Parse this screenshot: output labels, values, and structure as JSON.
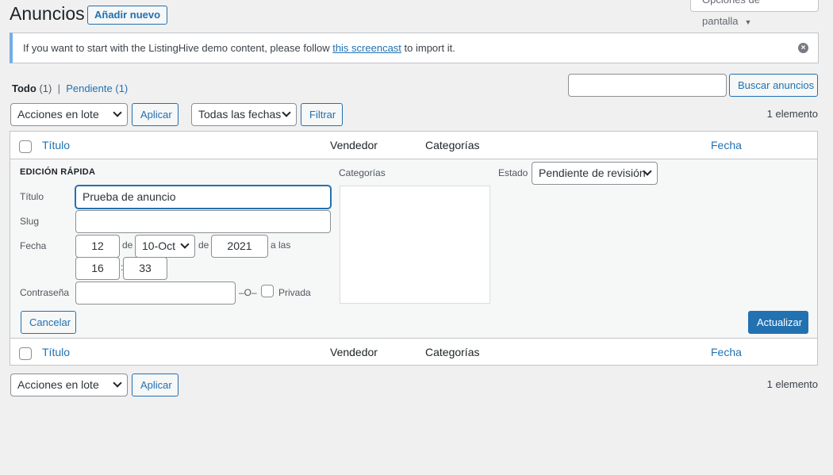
{
  "header": {
    "title": "Anuncios",
    "add_new": "Añadir nuevo",
    "screen_options": "Opciones de pantalla"
  },
  "notice": {
    "text_before": "If you want to start with the ListingHive demo content, please follow ",
    "link": "this screencast",
    "text_after": " to import it."
  },
  "views": {
    "all_label": "Todo",
    "all_count": "(1)",
    "separator": "|",
    "pending_label": "Pendiente",
    "pending_count": "(1)"
  },
  "search": {
    "value": "",
    "button": "Buscar anuncios"
  },
  "tablenav_top": {
    "bulk_actions": "Acciones en lote",
    "apply": "Aplicar",
    "dates": "Todas las fechas",
    "filter": "Filtrar",
    "count": "1 elemento"
  },
  "columns": {
    "title": "Título",
    "vendor": "Vendedor",
    "categories": "Categorías",
    "date": "Fecha"
  },
  "quick_edit": {
    "heading": "EDICIÓN RÁPIDA",
    "title_label": "Título",
    "title_value": "Prueba de anuncio",
    "slug_label": "Slug",
    "slug_value": "",
    "date_label": "Fecha",
    "day": "12",
    "de1": "de",
    "month": "10-Oct",
    "de2": "de",
    "year": "2021",
    "at": "a las",
    "hour": "16",
    "colon": ":",
    "minute": "33",
    "password_label": "Contraseña",
    "password_value": "",
    "or": "–O–",
    "private_label": "Privada",
    "categories_label": "Categorías",
    "status_label": "Estado",
    "status_value": "Pendiente de revisión",
    "cancel": "Cancelar",
    "update": "Actualizar"
  },
  "tablenav_bottom": {
    "bulk_actions": "Acciones en lote",
    "apply": "Aplicar",
    "count": "1 elemento"
  }
}
